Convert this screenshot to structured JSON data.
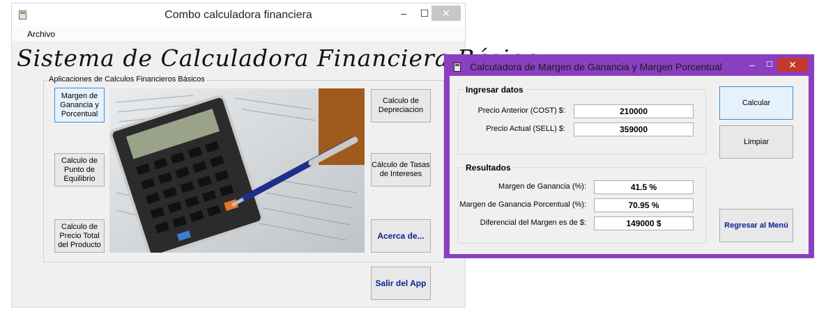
{
  "main_window": {
    "title": "Combo calculadora financiera",
    "menu": [
      "Archivo"
    ],
    "heading": "Sistema de Calculadora Financiera Básica",
    "group_caption": "Aplicaciones de Calculos Financieros Básicos",
    "buttons": {
      "margen": "Margen de Ganancia y Porcentual",
      "equilibrio": "Calculo de Punto de Equilibrio",
      "precio_total": "Calculo de Precio Total del Producto",
      "depreciacion": "Calculo de Depreciacion",
      "tasas": "Cálculo de Tasas de Intereses",
      "acerca": "Acerca de...",
      "salir": "Salir del App"
    }
  },
  "margin_window": {
    "title": "Calculadora de Margen de Ganancia y Margen Porcentual",
    "input_group": {
      "caption": "Ingresar datos",
      "precio_anterior_label": "Precio Anterior (COST) $:",
      "precio_anterior_value": "210000",
      "precio_actual_label": "Precio Actual (SELL) $:",
      "precio_actual_value": "359000"
    },
    "results_group": {
      "caption": "Resultados",
      "margen_label": "Margen de Ganancia (%):",
      "margen_value": "41.5 %",
      "margen_porcentual_label": "Margen de Ganancia Porcentual (%):",
      "margen_porcentual_value": "70.95 %",
      "diferencial_label": "Diferencial del Margen es de $:",
      "diferencial_value": "149000 $"
    },
    "buttons": {
      "calcular": "Calcular",
      "limpiar": "Limpiar",
      "regresar": "Regresar al Menú"
    }
  },
  "window_controls": {
    "minimize": "–",
    "maximize": "☐",
    "close": "✕"
  }
}
